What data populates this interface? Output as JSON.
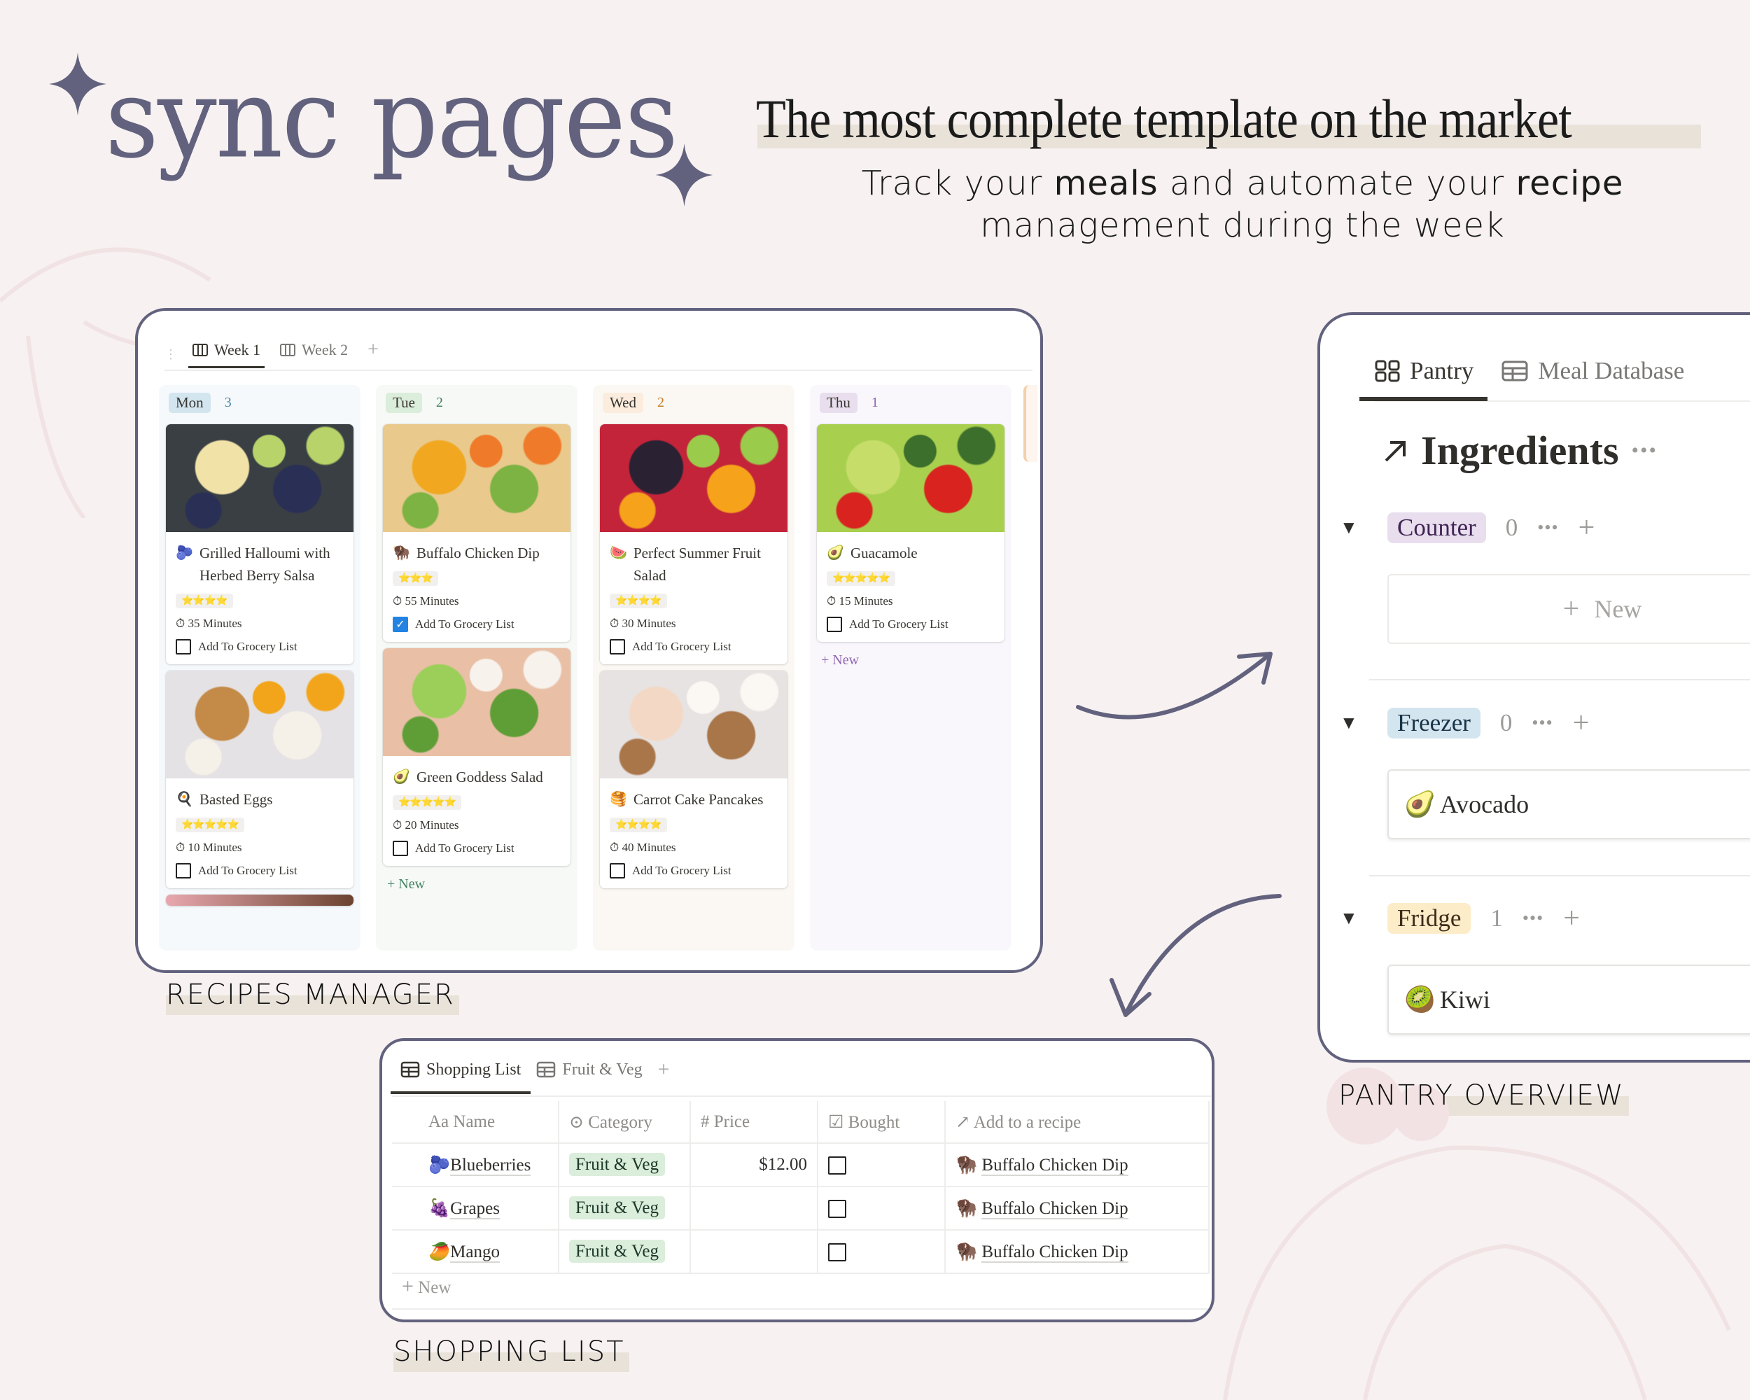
{
  "brand": {
    "title": "sync pages"
  },
  "tagline": "The most complete template on the market",
  "subtitle": {
    "line1_parts": [
      "Track your ",
      "meals",
      " and automate your ",
      "recipe"
    ],
    "line2": "management during the week"
  },
  "recipes_manager": {
    "label": "RECIPES MANAGER",
    "tabs": [
      {
        "label": "Week 1",
        "icon": "board-icon",
        "active": true
      },
      {
        "label": "Week 2",
        "icon": "board-icon",
        "active": false
      }
    ],
    "add_tab": "+",
    "columns": [
      {
        "day": "Mon",
        "count": "3",
        "tag_bg": "#d3e5ef",
        "col_bg": "#f5f9fb",
        "count_color": "#4a84a8",
        "cards": [
          {
            "emoji": "🫐",
            "title": "Grilled Halloumi with Herbed Berry Salsa",
            "stars": "⭐⭐⭐⭐",
            "rating": 4,
            "minutes": "35 Minutes",
            "grocery_label": "Add To Grocery List",
            "grocery_checked": false,
            "cover": [
              "#3a3f44",
              "#f1e2a8",
              "#2a2f55",
              "#b8d36a"
            ]
          },
          {
            "emoji": "🍳",
            "title": "Basted Eggs",
            "stars": "⭐⭐⭐⭐⭐",
            "rating": 5,
            "minutes": "10 Minutes",
            "grocery_label": "Add To Grocery List",
            "grocery_checked": false,
            "cover": [
              "#e4e2e4",
              "#c48a48",
              "#f6f1e8",
              "#f2a51a"
            ]
          }
        ],
        "new_label": ""
      },
      {
        "day": "Tue",
        "count": "2",
        "tag_bg": "#dbeddb",
        "col_bg": "#f6f9f6",
        "count_color": "#448361",
        "cards": [
          {
            "emoji": "🦬",
            "title": "Buffalo Chicken Dip",
            "stars": "⭐⭐⭐",
            "rating": 3,
            "minutes": "55 Minutes",
            "grocery_label": "Add To Grocery List",
            "grocery_checked": true,
            "cover": [
              "#e9c98c",
              "#f1a820",
              "#7cb342",
              "#ef7a2a"
            ]
          },
          {
            "emoji": "🥑",
            "title": "Green Goddess Salad",
            "stars": "⭐⭐⭐⭐⭐",
            "rating": 5,
            "minutes": "20 Minutes",
            "grocery_label": "Add To Grocery List",
            "grocery_checked": false,
            "cover": [
              "#e9bfa6",
              "#9ccf5a",
              "#5f9e36",
              "#f7f2ec"
            ]
          }
        ],
        "new_label": "New"
      },
      {
        "day": "Wed",
        "count": "2",
        "tag_bg": "#fbecdd",
        "col_bg": "#fbf8f3",
        "count_color": "#c27c2a",
        "cards": [
          {
            "emoji": "🍉",
            "title": "Perfect Summer Fruit Salad",
            "stars": "⭐⭐⭐⭐",
            "rating": 4,
            "minutes": "30 Minutes",
            "grocery_label": "Add To Grocery List",
            "grocery_checked": false,
            "cover": [
              "#c3243a",
              "#2a2233",
              "#f6a21a",
              "#9acb4a"
            ]
          },
          {
            "emoji": "🥞",
            "title": "Carrot Cake Pancakes",
            "stars": "⭐⭐⭐⭐",
            "rating": 4,
            "minutes": "40 Minutes",
            "grocery_label": "Add To Grocery List",
            "grocery_checked": false,
            "cover": [
              "#e6e3e2",
              "#f3d9c5",
              "#a9764a",
              "#fbf7f2"
            ]
          }
        ],
        "new_label": ""
      },
      {
        "day": "Thu",
        "count": "1",
        "tag_bg": "#e8deee",
        "col_bg": "#f9f7fc",
        "count_color": "#9065b0",
        "cards": [
          {
            "emoji": "🥑",
            "title": "Guacamole",
            "stars": "⭐⭐⭐⭐⭐",
            "rating": 5,
            "minutes": "15 Minutes",
            "grocery_label": "Add To Grocery List",
            "grocery_checked": false,
            "cover": [
              "#a9cf4f",
              "#c7dd6a",
              "#d8231f",
              "#3c6e2c"
            ]
          }
        ],
        "new_label": "New"
      }
    ]
  },
  "pantry": {
    "label": "PANTRY OVERVIEW",
    "tabs": [
      {
        "label": "Pantry",
        "icon": "gallery-icon",
        "active": true
      },
      {
        "label": "Meal Database",
        "icon": "table-icon",
        "active": false
      }
    ],
    "heading": "Ingredients",
    "heading_more": "•••",
    "groups": [
      {
        "name": "Counter",
        "count": "0",
        "tag_bg": "#e8deee",
        "text_color": "#412454",
        "items": [],
        "new_label": "New"
      },
      {
        "name": "Freezer",
        "count": "0",
        "tag_bg": "#d3e5ef",
        "text_color": "#183347",
        "items": [
          {
            "emoji": "🥑",
            "name": "Avocado"
          }
        ]
      },
      {
        "name": "Fridge",
        "count": "1",
        "tag_bg": "#fdecc8",
        "text_color": "#402c1b",
        "items": [
          {
            "emoji": "🥝",
            "name": "Kiwi"
          }
        ]
      }
    ]
  },
  "shopping": {
    "label": "SHOPPING LIST",
    "tabs": [
      {
        "label": "Shopping List",
        "icon": "table-icon",
        "active": true
      },
      {
        "label": "Fruit & Veg",
        "icon": "table-icon",
        "active": false
      }
    ],
    "columns": [
      {
        "icon": "Aa",
        "name": "Name"
      },
      {
        "icon": "⊙",
        "name": "Category"
      },
      {
        "icon": "#",
        "name": "Price"
      },
      {
        "icon": "☑",
        "name": "Bought"
      },
      {
        "icon": "↗",
        "name": "Add to a recipe"
      }
    ],
    "rows": [
      {
        "emoji": "🫐",
        "name": "Blueberries",
        "category": "Fruit & Veg",
        "price": "$12.00",
        "bought": false,
        "recipe_emoji": "🦬",
        "recipe": "Buffalo Chicken Dip"
      },
      {
        "emoji": "🍇",
        "name": "Grapes",
        "category": "Fruit & Veg",
        "price": "",
        "bought": false,
        "recipe_emoji": "🦬",
        "recipe": "Buffalo Chicken Dip"
      },
      {
        "emoji": "🥭",
        "name": "Mango",
        "category": "Fruit & Veg",
        "price": "",
        "bought": false,
        "recipe_emoji": "🦬",
        "recipe": "Buffalo Chicken Dip"
      }
    ],
    "new_label": "New"
  },
  "colors": {
    "accent": "#62627e",
    "background": "#f7f1f1",
    "highlight": "#e8e2d9",
    "checkbox_blue": "#2383e2"
  }
}
